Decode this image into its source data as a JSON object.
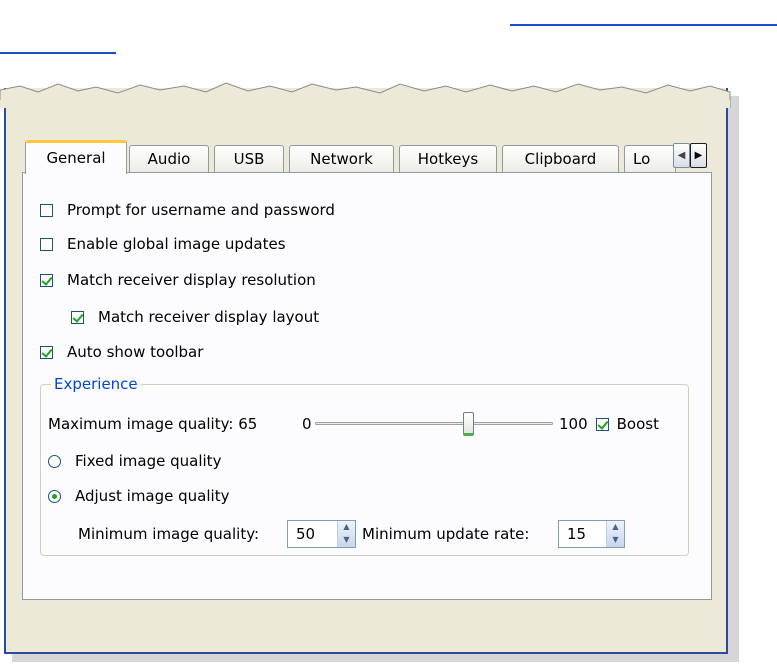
{
  "tabs": [
    {
      "label": "General",
      "active": true
    },
    {
      "label": "Audio",
      "active": false
    },
    {
      "label": "USB",
      "active": false
    },
    {
      "label": "Network",
      "active": false
    },
    {
      "label": "Hotkeys",
      "active": false
    },
    {
      "label": "Clipboard",
      "active": false
    },
    {
      "label": "Lo",
      "active": false
    }
  ],
  "tab_scroll": {
    "left_icon": "chevron-left-icon",
    "right_icon": "chevron-right-icon"
  },
  "options": {
    "prompt_credentials": {
      "label": "Prompt for username and password",
      "checked": false
    },
    "global_image_updates": {
      "label": "Enable global image updates",
      "checked": false
    },
    "match_resolution": {
      "label": "Match receiver display resolution",
      "checked": true
    },
    "match_layout": {
      "label": "Match receiver display layout",
      "checked": true
    },
    "auto_show_toolbar": {
      "label": "Auto show toolbar",
      "checked": true
    }
  },
  "experience": {
    "title": "Experience",
    "max_quality_label": "Maximum image quality: 65",
    "slider_min": "0",
    "slider_max": "100",
    "slider_value": 65,
    "boost": {
      "label": "Boost",
      "checked": true
    },
    "fixed_quality": {
      "label": "Fixed image quality",
      "selected": false
    },
    "adjust_quality": {
      "label": "Adjust image quality",
      "selected": true
    },
    "min_quality": {
      "label": "Minimum image quality:",
      "value": "50"
    },
    "min_rate": {
      "label": "Minimum update rate:",
      "value": "15"
    }
  },
  "colors": {
    "accent": "#0046d5",
    "check": "#21a121",
    "active_tab_highlight": "#ffc83c",
    "window_border": "#2a4a9e"
  }
}
